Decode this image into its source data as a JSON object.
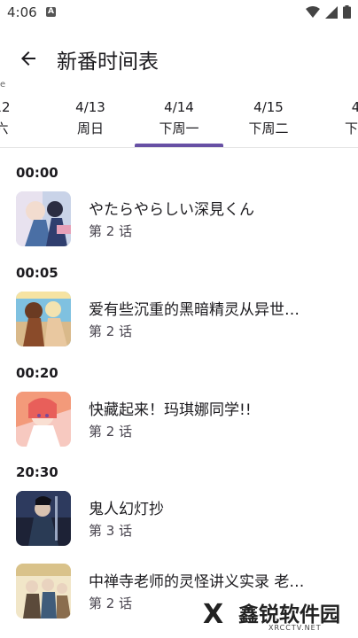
{
  "status_bar": {
    "time": "4:06",
    "notification_icon_letter": "A"
  },
  "app_bar": {
    "title": "新番时间表",
    "left_edge_char": "e"
  },
  "tabs": [
    {
      "date": "12",
      "day": "六"
    },
    {
      "date": "4/13",
      "day": "周日"
    },
    {
      "date": "4/14",
      "day": "下周一",
      "selected": true
    },
    {
      "date": "4/15",
      "day": "下周二"
    },
    {
      "date": "4/",
      "day": "下周"
    }
  ],
  "accent_color": "#6750a4",
  "schedule": [
    {
      "time": "00:00",
      "title": "やたらやらしい深見くん",
      "episode": "第 2 话"
    },
    {
      "time": "00:05",
      "title": "爱有些沉重的黑暗精灵从异世…",
      "episode": "第 2 话"
    },
    {
      "time": "00:20",
      "title": "快藏起来！玛琪娜同学!!",
      "episode": "第 2 话"
    },
    {
      "time": "20:30",
      "title": "鬼人幻灯抄",
      "episode": "第 3 话"
    },
    {
      "time": "",
      "title": "中禅寺老师的灵怪讲义实录 老…",
      "episode": "第 2 话"
    }
  ],
  "watermark": {
    "name": "鑫锐软件园",
    "sub": "XRCCTV.NET",
    "mark": "X"
  }
}
